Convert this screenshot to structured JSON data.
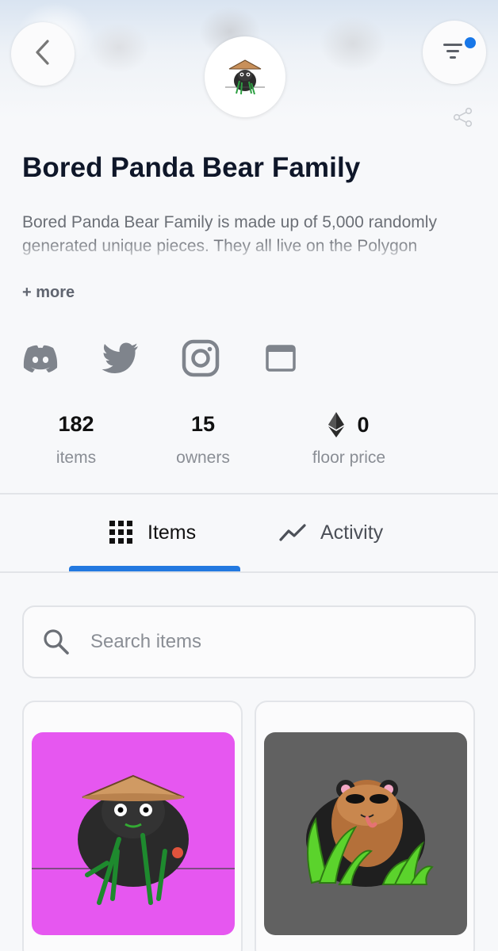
{
  "collection": {
    "title": "Bored Panda Bear Family",
    "description": "Bored Panda Bear Family is made up of 5,000 randomly generated unique pieces. They all live on the Polygon blockchain and highly concentrated in Polygon",
    "more_label": "+ more"
  },
  "social": [
    "discord-icon",
    "twitter-icon",
    "instagram-icon",
    "website-icon"
  ],
  "stats": {
    "items": {
      "value": "182",
      "label": "items"
    },
    "owners": {
      "value": "15",
      "label": "owners"
    },
    "floor": {
      "value": "0",
      "label": "floor price",
      "currency_icon": "ethereum-icon"
    }
  },
  "tabs": [
    {
      "label": "Items",
      "icon": "grid-icon",
      "active": true
    },
    {
      "label": "Activity",
      "icon": "trend-line-icon",
      "active": false
    }
  ],
  "search": {
    "placeholder": "Search items",
    "value": ""
  },
  "cards": [
    {
      "bg_color": "#e657f0",
      "image": "panda-with-straw-hat-and-bamboo"
    },
    {
      "bg_color": "#616161",
      "image": "brown-panda-with-sunglasses-in-grass"
    }
  ],
  "colors": {
    "accent": "#2379e0",
    "notification_dot": "#1877e8"
  }
}
